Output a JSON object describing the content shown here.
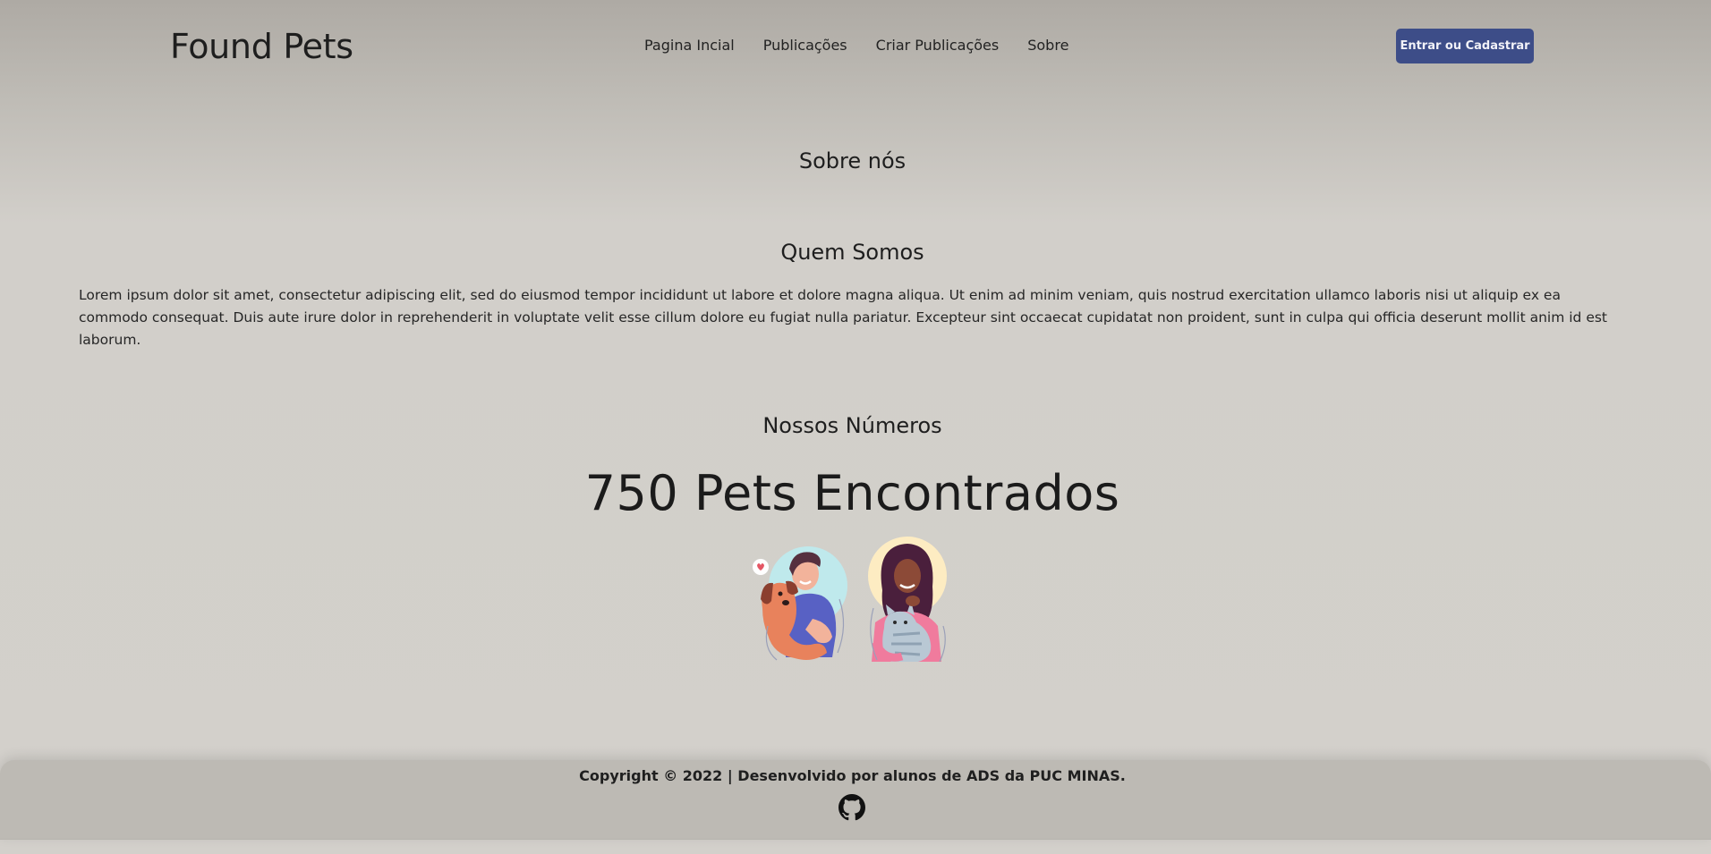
{
  "header": {
    "logo": "Found Pets",
    "nav": [
      "Pagina Incial",
      "Publicações",
      "Criar Publicações",
      "Sobre"
    ],
    "login_label": "Entrar ou Cadastrar"
  },
  "main": {
    "about_title": "Sobre nós",
    "who_title": "Quem Somos",
    "who_text": "Lorem ipsum dolor sit amet, consectetur adipiscing elit, sed do eiusmod tempor incididunt ut labore et dolore magna aliqua. Ut enim ad minim veniam, quis nostrud exercitation ullamco laboris nisi ut aliquip ex ea commodo consequat. Duis aute irure dolor in reprehenderit in voluptate velit esse cillum dolore eu fugiat nulla pariatur. Excepteur sint occaecat cupidatat non proident, sunt in culpa qui officia deserunt mollit anim id est laborum.",
    "numbers_title": "Nossos Números",
    "pets_found": "750 Pets Encontrados"
  },
  "footer": {
    "copyright": "Copyright © 2022 | Desenvolvido por alunos de ADS da PUC MINAS.",
    "github_icon": "github-icon"
  },
  "colors": {
    "accent": "#3d4d88",
    "footer_bg": "#bdbab4",
    "page_bg": "#d3d0cb"
  }
}
